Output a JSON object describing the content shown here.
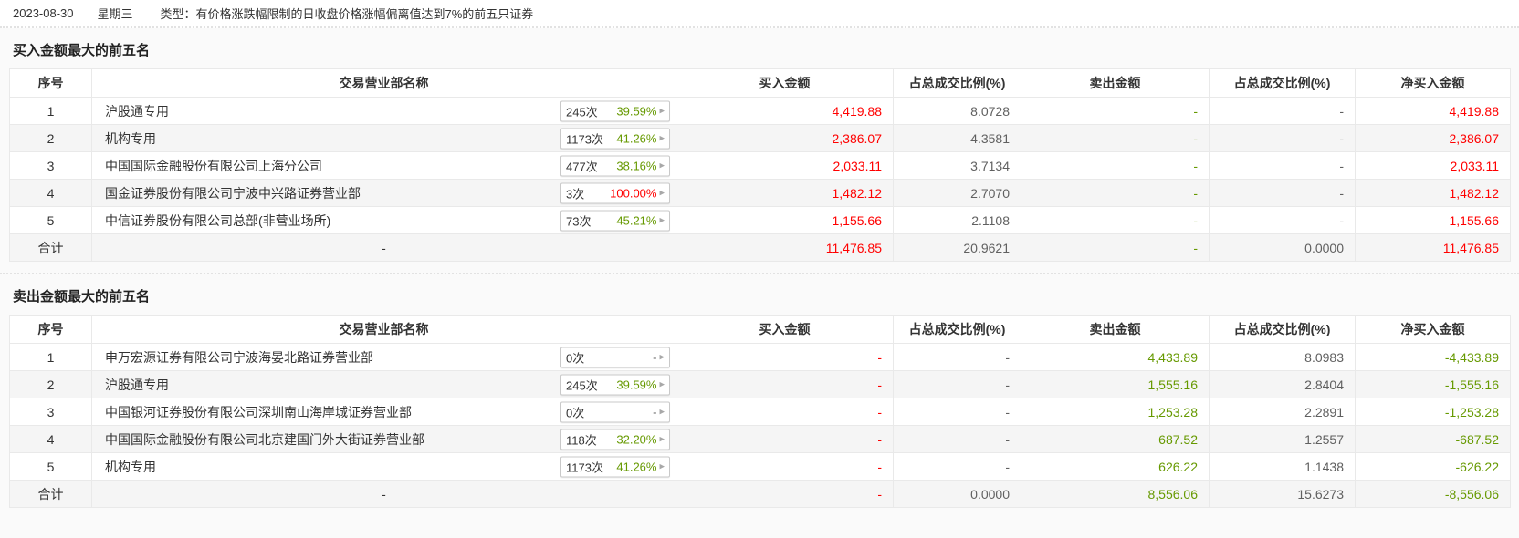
{
  "header": {
    "date": "2023-08-30",
    "weekday": "星期三",
    "type": "类型：有价格涨跌幅限制的日收盘价格涨幅偏离值达到7%的前五只证券"
  },
  "columns": [
    "序号",
    "交易营业部名称",
    "买入金额",
    "占总成交比例(%)",
    "卖出金额",
    "占总成交比例(%)",
    "净买入金额"
  ],
  "colors": {
    "amount_red": "#ff0000",
    "amount_green": "#669900",
    "ratio_gray": "#606060",
    "alt_row_bg": "#f5f5f5"
  },
  "buy_section": {
    "title": "买入金额最大的前五名",
    "rows": [
      {
        "no": "1",
        "name": "沪股通专用",
        "badge": {
          "count": "245次",
          "pct": "39.59%",
          "pct_color": "green"
        },
        "cells": [
          {
            "t": "4,419.88",
            "c": "red"
          },
          {
            "t": "8.0728",
            "c": "gray"
          },
          {
            "t": "-",
            "c": "green"
          },
          {
            "t": "-",
            "c": "gray"
          },
          {
            "t": "4,419.88",
            "c": "red"
          }
        ]
      },
      {
        "no": "2",
        "name": "机构专用",
        "badge": {
          "count": "1173次",
          "pct": "41.26%",
          "pct_color": "green"
        },
        "cells": [
          {
            "t": "2,386.07",
            "c": "red"
          },
          {
            "t": "4.3581",
            "c": "gray"
          },
          {
            "t": "-",
            "c": "green"
          },
          {
            "t": "-",
            "c": "gray"
          },
          {
            "t": "2,386.07",
            "c": "red"
          }
        ]
      },
      {
        "no": "3",
        "name": "中国国际金融股份有限公司上海分公司",
        "badge": {
          "count": "477次",
          "pct": "38.16%",
          "pct_color": "green"
        },
        "cells": [
          {
            "t": "2,033.11",
            "c": "red"
          },
          {
            "t": "3.7134",
            "c": "gray"
          },
          {
            "t": "-",
            "c": "green"
          },
          {
            "t": "-",
            "c": "gray"
          },
          {
            "t": "2,033.11",
            "c": "red"
          }
        ]
      },
      {
        "no": "4",
        "name": "国金证券股份有限公司宁波中兴路证券营业部",
        "badge": {
          "count": "3次",
          "pct": "100.00%",
          "pct_color": "red"
        },
        "cells": [
          {
            "t": "1,482.12",
            "c": "red"
          },
          {
            "t": "2.7070",
            "c": "gray"
          },
          {
            "t": "-",
            "c": "green"
          },
          {
            "t": "-",
            "c": "gray"
          },
          {
            "t": "1,482.12",
            "c": "red"
          }
        ]
      },
      {
        "no": "5",
        "name": "中信证券股份有限公司总部(非营业场所)",
        "badge": {
          "count": "73次",
          "pct": "45.21%",
          "pct_color": "green"
        },
        "cells": [
          {
            "t": "1,155.66",
            "c": "red"
          },
          {
            "t": "2.1108",
            "c": "gray"
          },
          {
            "t": "-",
            "c": "green"
          },
          {
            "t": "-",
            "c": "gray"
          },
          {
            "t": "1,155.66",
            "c": "red"
          }
        ]
      }
    ],
    "total": {
      "no": "合计",
      "name": "-",
      "badge": null,
      "cells": [
        {
          "t": "11,476.85",
          "c": "red"
        },
        {
          "t": "20.9621",
          "c": "gray"
        },
        {
          "t": "-",
          "c": "green"
        },
        {
          "t": "0.0000",
          "c": "gray"
        },
        {
          "t": "11,476.85",
          "c": "red"
        }
      ]
    }
  },
  "sell_section": {
    "title": "卖出金额最大的前五名",
    "rows": [
      {
        "no": "1",
        "name": "申万宏源证券有限公司宁波海晏北路证券营业部",
        "badge": {
          "count": "0次",
          "pct": "-",
          "pct_color": "gray"
        },
        "cells": [
          {
            "t": "-",
            "c": "red"
          },
          {
            "t": "-",
            "c": "gray"
          },
          {
            "t": "4,433.89",
            "c": "green"
          },
          {
            "t": "8.0983",
            "c": "gray"
          },
          {
            "t": "-4,433.89",
            "c": "green"
          }
        ]
      },
      {
        "no": "2",
        "name": "沪股通专用",
        "badge": {
          "count": "245次",
          "pct": "39.59%",
          "pct_color": "green"
        },
        "cells": [
          {
            "t": "-",
            "c": "red"
          },
          {
            "t": "-",
            "c": "gray"
          },
          {
            "t": "1,555.16",
            "c": "green"
          },
          {
            "t": "2.8404",
            "c": "gray"
          },
          {
            "t": "-1,555.16",
            "c": "green"
          }
        ]
      },
      {
        "no": "3",
        "name": "中国银河证券股份有限公司深圳南山海岸城证券营业部",
        "badge": {
          "count": "0次",
          "pct": "-",
          "pct_color": "gray"
        },
        "cells": [
          {
            "t": "-",
            "c": "red"
          },
          {
            "t": "-",
            "c": "gray"
          },
          {
            "t": "1,253.28",
            "c": "green"
          },
          {
            "t": "2.2891",
            "c": "gray"
          },
          {
            "t": "-1,253.28",
            "c": "green"
          }
        ]
      },
      {
        "no": "4",
        "name": "中国国际金融股份有限公司北京建国门外大街证券营业部",
        "badge": {
          "count": "118次",
          "pct": "32.20%",
          "pct_color": "green"
        },
        "cells": [
          {
            "t": "-",
            "c": "red"
          },
          {
            "t": "-",
            "c": "gray"
          },
          {
            "t": "687.52",
            "c": "green"
          },
          {
            "t": "1.2557",
            "c": "gray"
          },
          {
            "t": "-687.52",
            "c": "green"
          }
        ]
      },
      {
        "no": "5",
        "name": "机构专用",
        "badge": {
          "count": "1173次",
          "pct": "41.26%",
          "pct_color": "green"
        },
        "cells": [
          {
            "t": "-",
            "c": "red"
          },
          {
            "t": "-",
            "c": "gray"
          },
          {
            "t": "626.22",
            "c": "green"
          },
          {
            "t": "1.1438",
            "c": "gray"
          },
          {
            "t": "-626.22",
            "c": "green"
          }
        ]
      }
    ],
    "total": {
      "no": "合计",
      "name": "-",
      "badge": null,
      "cells": [
        {
          "t": "-",
          "c": "red"
        },
        {
          "t": "0.0000",
          "c": "gray"
        },
        {
          "t": "8,556.06",
          "c": "green"
        },
        {
          "t": "15.6273",
          "c": "gray"
        },
        {
          "t": "-8,556.06",
          "c": "green"
        }
      ]
    }
  },
  "badge_arrow_icon": "▸"
}
